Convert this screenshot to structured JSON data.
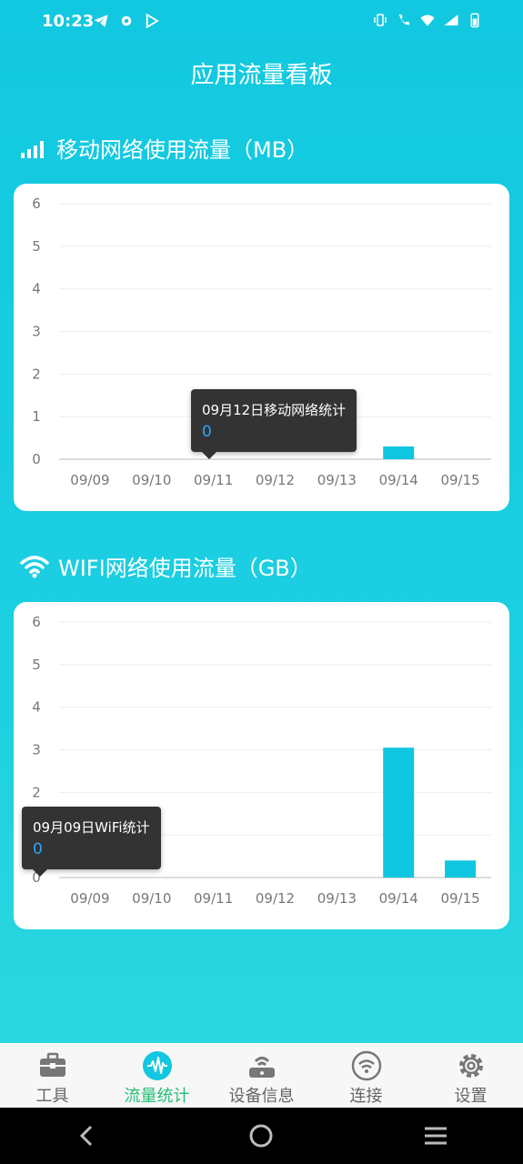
{
  "status_bar": {
    "time": "10:23"
  },
  "page_title": "应用流量看板",
  "mobile_section": {
    "title": "移动网络使用流量（MB）",
    "tooltip": {
      "title": "09月12日移动网络统计",
      "value": "0"
    }
  },
  "wifi_section": {
    "title": "WIFI网络使用流量（GB）",
    "tooltip": {
      "title": "09月09日WiFi统计",
      "value": "0"
    }
  },
  "chart_data": [
    {
      "type": "bar",
      "categories": [
        "09/09",
        "09/10",
        "09/11",
        "09/12",
        "09/13",
        "09/14",
        "09/15"
      ],
      "values": [
        0,
        0,
        0,
        0,
        0,
        0.3,
        0
      ],
      "ylim": [
        0,
        6
      ],
      "yticks": [
        "0",
        "1",
        "2",
        "3",
        "4",
        "5",
        "6"
      ],
      "grid": true,
      "color": "#0fc6e0"
    },
    {
      "type": "bar",
      "categories": [
        "09/09",
        "09/10",
        "09/11",
        "09/12",
        "09/13",
        "09/14",
        "09/15"
      ],
      "values": [
        0,
        0,
        0,
        0,
        0,
        3.05,
        0.4
      ],
      "ylim": [
        0,
        6
      ],
      "yticks": [
        "0",
        "1",
        "2",
        "3",
        "4",
        "5",
        "6"
      ],
      "grid": true,
      "color": "#0fc6e0"
    }
  ],
  "tabs": [
    {
      "label": "工具",
      "icon": "toolbox-icon",
      "active": false
    },
    {
      "label": "流量统计",
      "icon": "pulse-icon",
      "active": true
    },
    {
      "label": "设备信息",
      "icon": "router-icon",
      "active": false
    },
    {
      "label": "连接",
      "icon": "wifi-circle-icon",
      "active": false
    },
    {
      "label": "设置",
      "icon": "gear-icon",
      "active": false
    }
  ],
  "colors": {
    "accent": "#25bf74",
    "bar": "#0fc6e0",
    "header_bg": "#12c8e0"
  }
}
